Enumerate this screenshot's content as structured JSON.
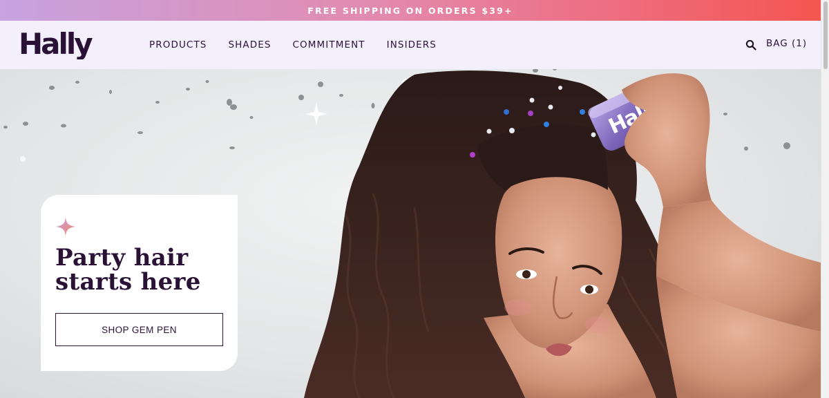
{
  "announcement": {
    "text": "FREE SHIPPING ON ORDERS $39+"
  },
  "brand": {
    "logo_text": "Hally"
  },
  "nav": {
    "items": [
      {
        "label": "PRODUCTS"
      },
      {
        "label": "SHADES"
      },
      {
        "label": "COMMITMENT"
      },
      {
        "label": "INSIDERS"
      }
    ]
  },
  "header": {
    "search_icon": "search-icon",
    "bag_label": "BAG (1)"
  },
  "hero": {
    "headline": "Party hair starts here",
    "cta_label": "SHOP GEM PEN",
    "product_label": "Hally",
    "sparkle_icon": "sparkle-icon"
  },
  "colors": {
    "brand_purple": "#2a1237",
    "header_bg": "#f3effd",
    "announce_gradient_start": "#c7a3e0",
    "announce_gradient_end": "#f4554f"
  }
}
